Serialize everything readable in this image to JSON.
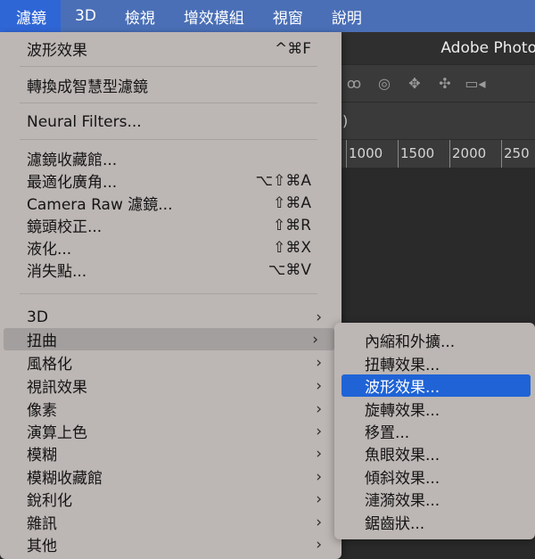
{
  "menubar": {
    "items": [
      "濾鏡",
      "3D",
      "檢視",
      "增效模組",
      "視窗",
      "說明"
    ]
  },
  "photoshop": {
    "title": "Adobe Photo",
    "tab_text": ")",
    "ruler_labels": [
      "1000",
      "1500",
      "2000",
      "250"
    ]
  },
  "filter_menu": {
    "wave": {
      "label": "波形效果",
      "shortcut": "^⌘F"
    },
    "smart_filters": {
      "label": "轉換成智慧型濾鏡"
    },
    "neural_filters": {
      "label": "Neural Filters..."
    },
    "gallery": {
      "label": "濾鏡收藏館..."
    },
    "adaptive_wide": {
      "label": "最適化廣角...",
      "shortcut": "⌥⇧⌘A"
    },
    "camera_raw": {
      "label": "Camera Raw 濾鏡...",
      "shortcut": "⇧⌘A"
    },
    "lens_correction": {
      "label": "鏡頭校正...",
      "shortcut": "⇧⌘R"
    },
    "liquify": {
      "label": "液化...",
      "shortcut": "⇧⌘X"
    },
    "vanishing_point": {
      "label": "消失點...",
      "shortcut": "⌥⌘V"
    },
    "submenus": [
      "3D",
      "扭曲",
      "風格化",
      "視訊效果",
      "像素",
      "演算上色",
      "模糊",
      "模糊收藏館",
      "銳利化",
      "雜訊",
      "其他"
    ]
  },
  "distort_submenu": {
    "items": [
      "內縮和外擴...",
      "扭轉效果...",
      "波形效果...",
      "旋轉效果...",
      "移置...",
      "魚眼效果...",
      "傾斜效果...",
      "漣漪效果...",
      "鋸齒狀..."
    ]
  }
}
